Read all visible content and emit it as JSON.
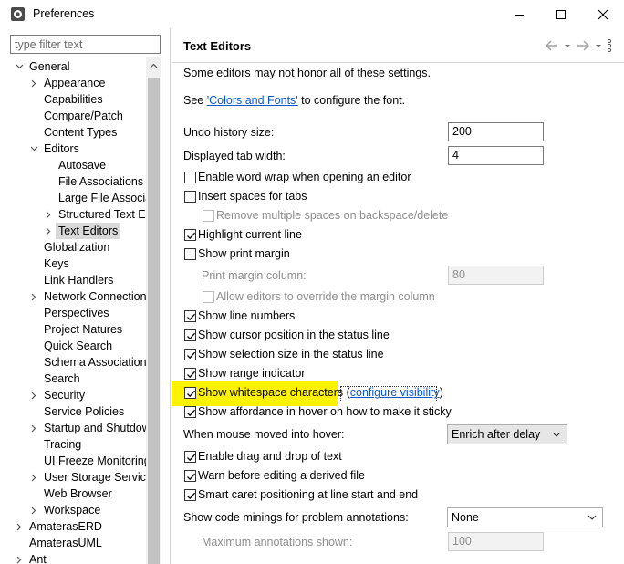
{
  "window": {
    "title": "Preferences"
  },
  "left": {
    "filter_placeholder": "type filter text",
    "tree": [
      {
        "label": "General",
        "twisty": "expanded",
        "level": 1
      },
      {
        "label": "Appearance",
        "twisty": "collapsed",
        "level": 2
      },
      {
        "label": "Capabilities",
        "twisty": "none",
        "level": 2
      },
      {
        "label": "Compare/Patch",
        "twisty": "none",
        "level": 2
      },
      {
        "label": "Content Types",
        "twisty": "none",
        "level": 2
      },
      {
        "label": "Editors",
        "twisty": "expanded",
        "level": 2
      },
      {
        "label": "Autosave",
        "twisty": "none",
        "level": 3
      },
      {
        "label": "File Associations",
        "twisty": "none",
        "level": 3
      },
      {
        "label": "Large File Associa",
        "twisty": "none",
        "level": 3
      },
      {
        "label": "Structured Text Ec",
        "twisty": "collapsed",
        "level": 3
      },
      {
        "label": "Text Editors",
        "twisty": "collapsed",
        "level": 3,
        "selected": true
      },
      {
        "label": "Globalization",
        "twisty": "none",
        "level": 2
      },
      {
        "label": "Keys",
        "twisty": "none",
        "level": 2
      },
      {
        "label": "Link Handlers",
        "twisty": "none",
        "level": 2
      },
      {
        "label": "Network Connection",
        "twisty": "collapsed",
        "level": 2
      },
      {
        "label": "Perspectives",
        "twisty": "none",
        "level": 2
      },
      {
        "label": "Project Natures",
        "twisty": "none",
        "level": 2
      },
      {
        "label": "Quick Search",
        "twisty": "none",
        "level": 2
      },
      {
        "label": "Schema Associations",
        "twisty": "none",
        "level": 2
      },
      {
        "label": "Search",
        "twisty": "none",
        "level": 2
      },
      {
        "label": "Security",
        "twisty": "collapsed",
        "level": 2
      },
      {
        "label": "Service Policies",
        "twisty": "none",
        "level": 2
      },
      {
        "label": "Startup and Shutdow",
        "twisty": "collapsed",
        "level": 2
      },
      {
        "label": "Tracing",
        "twisty": "none",
        "level": 2
      },
      {
        "label": "UI Freeze Monitoring",
        "twisty": "none",
        "level": 2
      },
      {
        "label": "User Storage Service",
        "twisty": "collapsed",
        "level": 2
      },
      {
        "label": "Web Browser",
        "twisty": "none",
        "level": 2
      },
      {
        "label": "Workspace",
        "twisty": "collapsed",
        "level": 2
      },
      {
        "label": "AmaterasERD",
        "twisty": "collapsed",
        "level": 1
      },
      {
        "label": "AmaterasUML",
        "twisty": "none",
        "level": 1
      },
      {
        "label": "Ant",
        "twisty": "collapsed",
        "level": 1
      }
    ]
  },
  "page": {
    "title": "Text Editors",
    "note": "Some editors may not honor all of these settings.",
    "see_prefix": "See ",
    "see_link": "'Colors and Fonts'",
    "see_suffix": " to configure the font.",
    "undo_label": "Undo history size:",
    "undo_value": "200",
    "tab_label": "Displayed tab width:",
    "tab_value": "4",
    "word_wrap": "Enable word wrap when opening an editor",
    "insert_spaces": "Insert spaces for tabs",
    "remove_spaces": "Remove multiple spaces on backspace/delete",
    "highlight_line": "Highlight current line",
    "print_margin": "Show print margin",
    "print_margin_col_label": "Print margin column:",
    "print_margin_col_value": "80",
    "allow_override": "Allow editors to override the margin column",
    "line_numbers": "Show line numbers",
    "cursor_pos": "Show cursor position in the status line",
    "selection_size": "Show selection size in the status line",
    "range_indicator": "Show range indicator",
    "whitespace": "Show whitespace characters",
    "whitespace_paren_open": "(",
    "whitespace_link": "configure visibility",
    "whitespace_paren_close": ")",
    "affordance": "Show affordance in hover on how to make it sticky",
    "hover_label": "When mouse moved into hover:",
    "hover_value": "Enrich after delay",
    "drag_drop": "Enable drag and drop of text",
    "warn_derived": "Warn before editing a derived file",
    "smart_caret": "Smart caret positioning at line start and end",
    "minings_label": "Show code minings for problem annotations:",
    "minings_value": "None",
    "max_annot_label": "Maximum annotations shown:",
    "max_annot_value": "100"
  },
  "colors": {
    "highlight": "#fff200",
    "link": "#0b58c4",
    "selection": "#d9d9d9"
  }
}
